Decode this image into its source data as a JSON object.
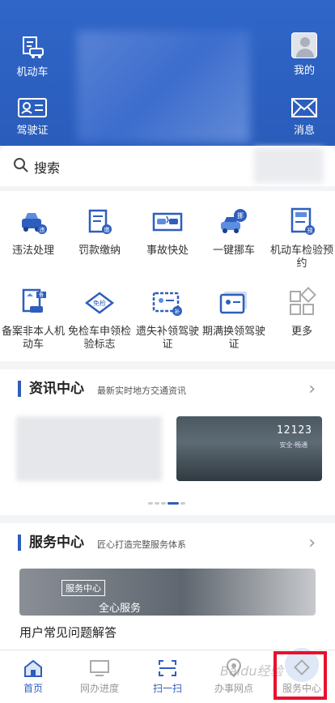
{
  "header": {
    "left_top_label": "机动车",
    "left_bottom_label": "驾驶证",
    "right_top_label": "我的",
    "right_bottom_label": "消息"
  },
  "search": {
    "placeholder": "搜索"
  },
  "services": [
    {
      "label": "违法处理",
      "icon": "car-violation-icon"
    },
    {
      "label": "罚款缴纳",
      "icon": "fine-payment-icon"
    },
    {
      "label": "事故快处",
      "icon": "accident-icon"
    },
    {
      "label": "一键挪车",
      "icon": "move-car-icon"
    },
    {
      "label": "机动车检验预约",
      "icon": "inspection-appointment-icon"
    },
    {
      "label": "备案非本人机动车",
      "icon": "record-vehicle-icon"
    },
    {
      "label": "免检车申领检验标志",
      "icon": "exempt-label-icon"
    },
    {
      "label": "遗失补领驾驶证",
      "icon": "reissue-license-icon"
    },
    {
      "label": "期满换领驾驶证",
      "icon": "renew-license-icon"
    },
    {
      "label": "更多",
      "icon": "more-icon"
    }
  ],
  "news": {
    "title": "资讯中心",
    "subtitle": "最新实时地方交通资讯",
    "banner_label": "12123",
    "banner_sub": "安全·畅通"
  },
  "service_center": {
    "title": "服务中心",
    "subtitle": "匠心打造完整服务体系",
    "badge": "服务中心",
    "banner_text": "全心服务",
    "faq": "用户常见问题解答"
  },
  "bottom_nav": [
    {
      "label": "首页",
      "icon": "home-icon",
      "active": true
    },
    {
      "label": "网办进度",
      "icon": "monitor-icon",
      "active": false
    },
    {
      "label": "扫一扫",
      "icon": "scan-icon",
      "active": false
    },
    {
      "label": "办事网点",
      "icon": "location-icon",
      "active": false
    },
    {
      "label": "服务中心",
      "icon": "service-center-icon",
      "active": false
    }
  ],
  "watermark": "Baidu经验",
  "colors": {
    "primary": "#2e5ebd",
    "header": "#2f66c8",
    "highlight": "#e8112d"
  }
}
